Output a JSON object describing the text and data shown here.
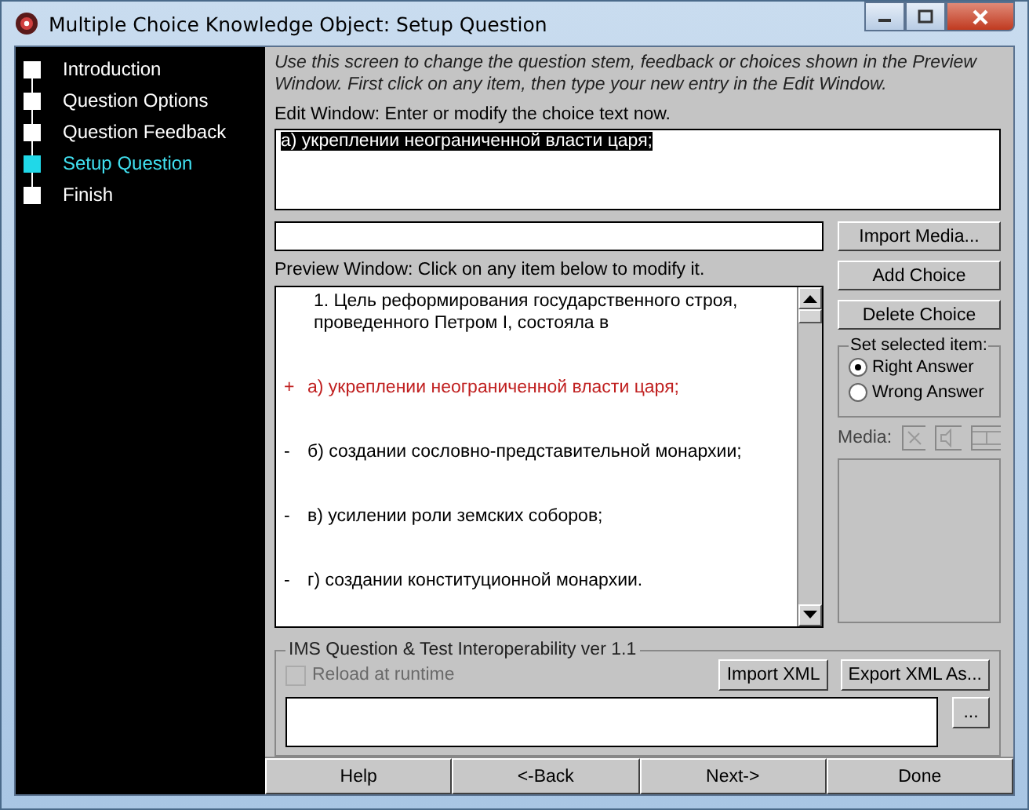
{
  "window": {
    "title": "Multiple Choice Knowledge Object: Setup Question"
  },
  "sidebar": {
    "items": [
      {
        "label": "Introduction",
        "selected": false
      },
      {
        "label": "Question Options",
        "selected": false
      },
      {
        "label": "Question Feedback",
        "selected": false
      },
      {
        "label": "Setup Question",
        "selected": true
      },
      {
        "label": "Finish",
        "selected": false
      }
    ]
  },
  "instructions": "Use this screen to change the question stem, feedback or choices shown in the Preview Window. First click on any item, then type your new entry in the Edit Window.",
  "edit_window": {
    "label": "Edit Window: Enter or modify the choice text now.",
    "value": "а) укреплении неограниченной власти царя;"
  },
  "media_path": {
    "button": "Import Media..."
  },
  "preview": {
    "label": "Preview Window: Click on any item below to modify it.",
    "stem": "1. Цель реформирования государственного строя, проведенного Петром I, состояла в",
    "choices": [
      {
        "marker": "+",
        "text": "а) укреплении неограниченной власти царя;",
        "correct": true
      },
      {
        "marker": "-",
        "text": "б) создании сословно-представительной монархии;",
        "correct": false
      },
      {
        "marker": "-",
        "text": "в) усилении роли земских соборов;",
        "correct": false
      },
      {
        "marker": "-",
        "text": "г) создании конституционной монархии.",
        "correct": false
      }
    ]
  },
  "choice_buttons": [
    "Add Choice",
    "Delete Choice"
  ],
  "set_selected": {
    "title": "Set selected item:",
    "options": [
      {
        "label": "Right Answer",
        "selected": true
      },
      {
        "label": "Wrong Answer",
        "selected": false
      }
    ]
  },
  "media": {
    "label": "Media:"
  },
  "ims": {
    "title": "IMS Question & Test Interoperability ver 1.1",
    "reload": {
      "label": "Reload at runtime",
      "checked": false,
      "disabled": true
    },
    "buttons": [
      "Import XML",
      "Export XML As..."
    ],
    "browse": "..."
  },
  "nav_buttons": [
    "Help",
    "<-Back",
    "Next->",
    "Done"
  ]
}
